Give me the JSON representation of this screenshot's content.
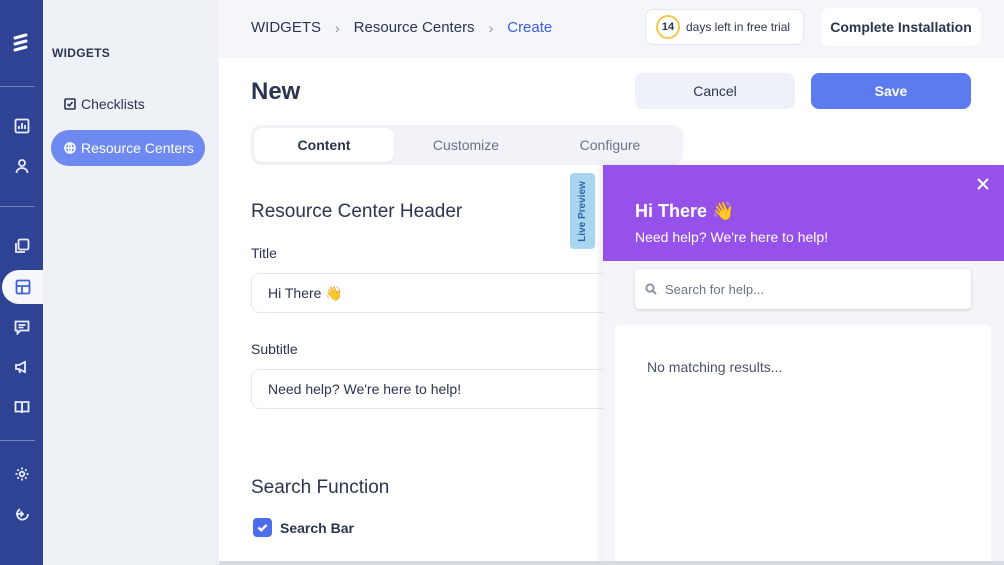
{
  "sidebar": {
    "section_title": "WIDGETS",
    "items": [
      {
        "label": "Checklists",
        "icon": "checkbox-icon",
        "active": false
      },
      {
        "label": "Resource Centers",
        "icon": "globe-icon",
        "active": true
      }
    ]
  },
  "breadcrumb": {
    "items": [
      "WIDGETS",
      "Resource Centers",
      "Create"
    ]
  },
  "trial": {
    "days": "14",
    "text": "days left in free trial"
  },
  "header": {
    "complete_label": "Complete Installation",
    "title": "New",
    "cancel_label": "Cancel",
    "save_label": "Save"
  },
  "tabs": [
    {
      "label": "Content",
      "active": true
    },
    {
      "label": "Customize",
      "active": false
    },
    {
      "label": "Configure",
      "active": false
    }
  ],
  "form": {
    "header_section": "Resource Center Header",
    "title_label": "Title",
    "title_value": "Hi There 👋",
    "subtitle_label": "Subtitle",
    "subtitle_value": "Need help? We're here to help!",
    "search_section": "Search Function",
    "search_bar_label": "Search Bar",
    "search_bar_checked": true
  },
  "live_preview": {
    "tab_label": "Live Preview",
    "title": "Hi There 👋",
    "subtitle": "Need help? We're here to help!",
    "search_placeholder": "Search for help...",
    "empty_text": "No matching results..."
  },
  "colors": {
    "rail": "#2e4393",
    "accent": "#5b7bef",
    "preview_header": "#9551ea"
  }
}
